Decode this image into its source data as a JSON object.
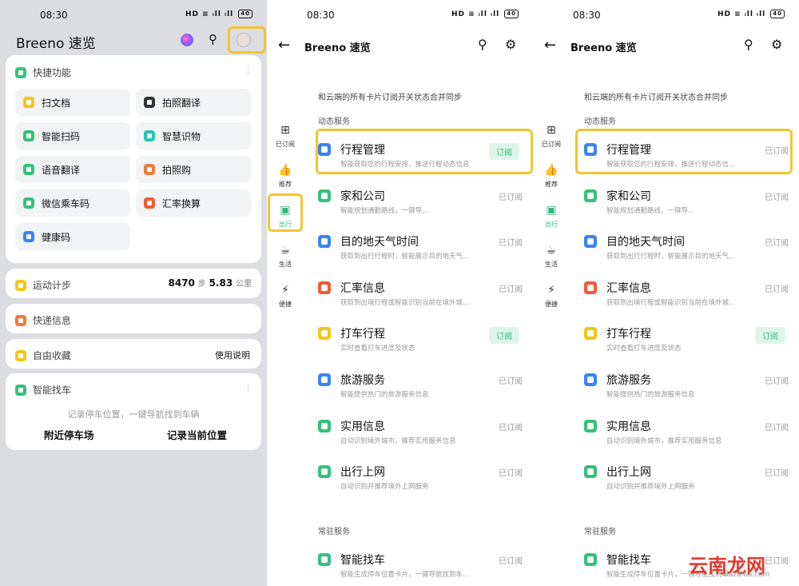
{
  "colors": {
    "accent": "#2fb87a",
    "highlight": "#f4c430"
  },
  "status": {
    "time": "08:30",
    "net": "HD ≡ ᵢll ᵢll",
    "battery": "40"
  },
  "p1": {
    "title": "Breeno 速览",
    "quick": {
      "title": "快捷功能",
      "items": [
        {
          "label": "扫文档",
          "icon": "scan-doc-icon"
        },
        {
          "label": "拍照翻译",
          "icon": "camera-translate-icon"
        },
        {
          "label": "智能扫码",
          "icon": "qr-scan-icon"
        },
        {
          "label": "智慧识物",
          "icon": "object-recognition-icon"
        },
        {
          "label": "语音翻译",
          "icon": "voice-translate-icon"
        },
        {
          "label": "拍照购",
          "icon": "photo-shop-icon"
        },
        {
          "label": "微信乘车码",
          "icon": "wechat-bus-icon"
        },
        {
          "label": "汇率换算",
          "icon": "exchange-icon"
        },
        {
          "label": "健康码",
          "icon": "health-code-icon"
        }
      ]
    },
    "steps": {
      "label": "运动计步",
      "count": "8470",
      "count_unit": "步",
      "distance": "5.83",
      "distance_unit": "公里"
    },
    "express": {
      "label": "快递信息"
    },
    "fav": {
      "label": "自由收藏",
      "action": "使用说明"
    },
    "parking": {
      "label": "智能找车",
      "hint": "记录停车位置，一键导航找到车辆",
      "btn1": "附近停车场",
      "btn2": "记录当前位置"
    }
  },
  "p2": {
    "title": "Breeno 速览",
    "side": [
      {
        "label": "已订阅",
        "icon": "subscribed-icon"
      },
      {
        "label": "推荐",
        "icon": "thumbs-up-icon"
      },
      {
        "label": "出行",
        "icon": "travel-icon"
      },
      {
        "label": "生活",
        "icon": "life-icon"
      },
      {
        "label": "便捷",
        "icon": "lightning-icon"
      }
    ],
    "notice": "和云端的所有卡片订阅开关状态合并同步",
    "section1": "动态服务",
    "section2": "常驻服务",
    "items": [
      {
        "title": "行程管理",
        "sub": "智能获取您的行程安排，推送行程动态信息",
        "state": "订阅"
      },
      {
        "title": "家和公司",
        "sub": "智能规划通勤路线，一键导...",
        "state": "已订阅"
      },
      {
        "title": "目的地天气时间",
        "sub": "获取到出行行程时，智能展示目的地天气...",
        "state": "已订阅"
      },
      {
        "title": "汇率信息",
        "sub": "获取到出境行程或智能识别当前在境外城...",
        "state": "已订阅"
      },
      {
        "title": "打车行程",
        "sub": "实时查看打车进度及状态",
        "state": "订阅"
      },
      {
        "title": "旅游服务",
        "sub": "智能提供热门的旅游服务信息",
        "state": "已订阅"
      },
      {
        "title": "实用信息",
        "sub": "自动识别境外城市，推荐实用服务信息",
        "state": "已订阅"
      },
      {
        "title": "出行上网",
        "sub": "自动识别并推荐境外上网服务",
        "state": "已订阅"
      },
      {
        "title": "智能找车",
        "sub": "智能生成停车位置卡片，一键导航找到车...",
        "state": "已订阅"
      }
    ]
  },
  "p3": {
    "title": "Breeno 速览",
    "notice": "和云端的所有卡片订阅开关状态合并同步",
    "section1": "动态服务",
    "section2": "常驻服务",
    "items": [
      {
        "title": "行程管理",
        "sub": "智能获取您的行程安排，推送行程动态信...",
        "state": "已订阅"
      },
      {
        "title": "家和公司",
        "sub": "智能规划通勤路线，一键导...",
        "state": "已订阅"
      },
      {
        "title": "目的地天气时间",
        "sub": "获取到出行行程时，智能展示目的地天气...",
        "state": "已订阅"
      },
      {
        "title": "汇率信息",
        "sub": "获取到出境行程或智能识别当前在境外城...",
        "state": "已订阅"
      },
      {
        "title": "打车行程",
        "sub": "实时查看打车进度及状态",
        "state": "订阅"
      },
      {
        "title": "旅游服务",
        "sub": "智能提供热门的旅游服务信息",
        "state": "已订阅"
      },
      {
        "title": "实用信息",
        "sub": "自动识别境外城市，推荐实用服务信息",
        "state": "已订阅"
      },
      {
        "title": "出行上网",
        "sub": "自动识别并推荐境外上网服务",
        "state": "已订阅"
      },
      {
        "title": "智能找车",
        "sub": "智能生成停车位置卡片，一键导航找到车...",
        "state": "已订阅"
      }
    ]
  },
  "watermark": {
    "text": "云南龙网",
    "sub": "xiazaiba.com"
  }
}
